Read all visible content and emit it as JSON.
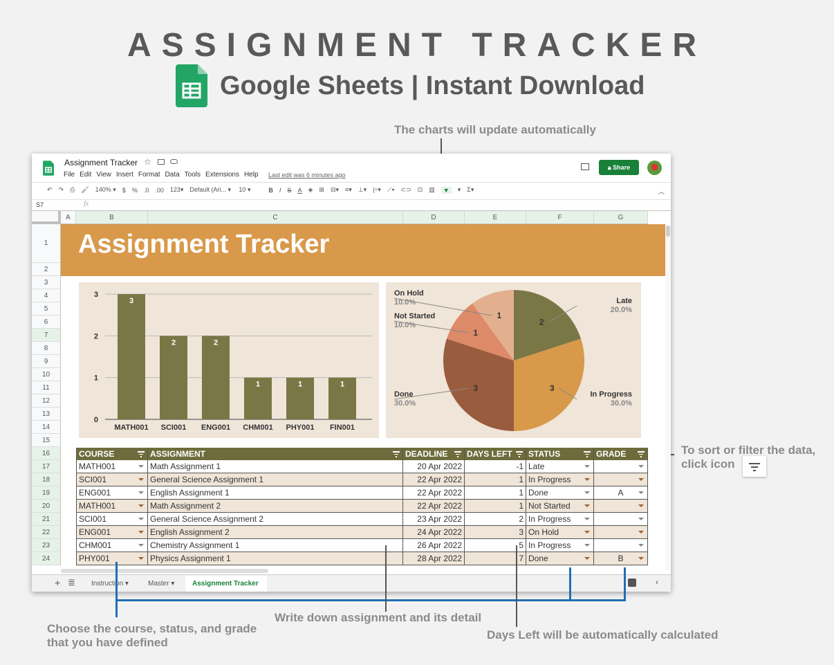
{
  "promo": {
    "headline": "ASSIGNMENT TRACKER",
    "subtitle": "Google Sheets | Instant Download"
  },
  "annotations": {
    "charts": "The charts will update automatically",
    "sort": "To sort or filter the data,",
    "sort2": "click icon",
    "choose": "Choose the course, status, and grade",
    "choose2": "that you have defined",
    "write": "Write down assignment and its detail",
    "days": "Days Left will be automatically calculated"
  },
  "app": {
    "doc_title": "Assignment Tracker",
    "menu": [
      "File",
      "Edit",
      "View",
      "Insert",
      "Format",
      "Data",
      "Tools",
      "Extensions",
      "Help"
    ],
    "last_edit": "Last edit was 6 minutes ago",
    "share": "Share",
    "toolbar": {
      "zoom": "140%",
      "currency": "$",
      "percent": "%",
      "dec_less": ".0",
      "dec_more": ".00",
      "format": "123",
      "font": "Default (Ari...",
      "size": "10"
    },
    "cell_ref": "S7",
    "fx": "fx"
  },
  "columns": [
    "A",
    "B",
    "C",
    "D",
    "E",
    "F",
    "G"
  ],
  "rows": [
    "1",
    "2",
    "3",
    "4",
    "5",
    "6",
    "7",
    "8",
    "9",
    "10",
    "11",
    "12",
    "13",
    "14",
    "15",
    "16",
    "17",
    "18",
    "19",
    "20",
    "21",
    "22",
    "23",
    "24"
  ],
  "banner": "Assignment Tracker",
  "table": {
    "headers": [
      "COURSE",
      "ASSIGNMENT",
      "DEADLINE",
      "DAYS LEFT",
      "STATUS",
      "GRADE"
    ],
    "rows": [
      [
        "MATH001",
        "Math Assignment 1",
        "20 Apr 2022",
        "-1",
        "Late",
        ""
      ],
      [
        "SCI001",
        "General Science Assignment 1",
        "22 Apr 2022",
        "1",
        "In Progress",
        ""
      ],
      [
        "ENG001",
        "English Assignment 1",
        "22 Apr 2022",
        "1",
        "Done",
        "A"
      ],
      [
        "MATH001",
        "Math Assignment 2",
        "22 Apr 2022",
        "1",
        "Not Started",
        ""
      ],
      [
        "SCI001",
        "General Science Assignment 2",
        "23 Apr 2022",
        "2",
        "In Progress",
        ""
      ],
      [
        "ENG001",
        "English Assignment 2",
        "24 Apr 2022",
        "3",
        "On Hold",
        ""
      ],
      [
        "CHM001",
        "Chemistry Assignment 1",
        "26 Apr 2022",
        "5",
        "In Progress",
        ""
      ],
      [
        "PHY001",
        "Physics Assignment 1",
        "28 Apr 2022",
        "7",
        "Done",
        "B"
      ]
    ]
  },
  "sheets": {
    "tabs": [
      "Instruction",
      "Master",
      "Assignment Tracker"
    ],
    "active": 2
  },
  "colors": {
    "banner": "#d8994a",
    "olive": "#7a7746",
    "chart_bg": "#efe5d8",
    "share": "#188038"
  },
  "chart_data": [
    {
      "type": "bar",
      "categories": [
        "MATH001",
        "SCI001",
        "ENG001",
        "CHM001",
        "PHY001",
        "FIN001"
      ],
      "values": [
        3,
        2,
        2,
        1,
        1,
        1
      ],
      "ylim": [
        0,
        3
      ],
      "yticks": [
        "0",
        "1",
        "2",
        "3"
      ],
      "grid": true
    },
    {
      "type": "pie",
      "labels": [
        "Late",
        "In Progress",
        "Done",
        "Not Started",
        "On Hold"
      ],
      "values": [
        2,
        3,
        3,
        1,
        1
      ],
      "percents": [
        "20.0%",
        "30.0%",
        "30.0%",
        "10.0%",
        "10.0%"
      ],
      "colors": [
        "#7a7746",
        "#d8994a",
        "#9a5c3e",
        "#dd8a68",
        "#e3b08f"
      ]
    }
  ]
}
